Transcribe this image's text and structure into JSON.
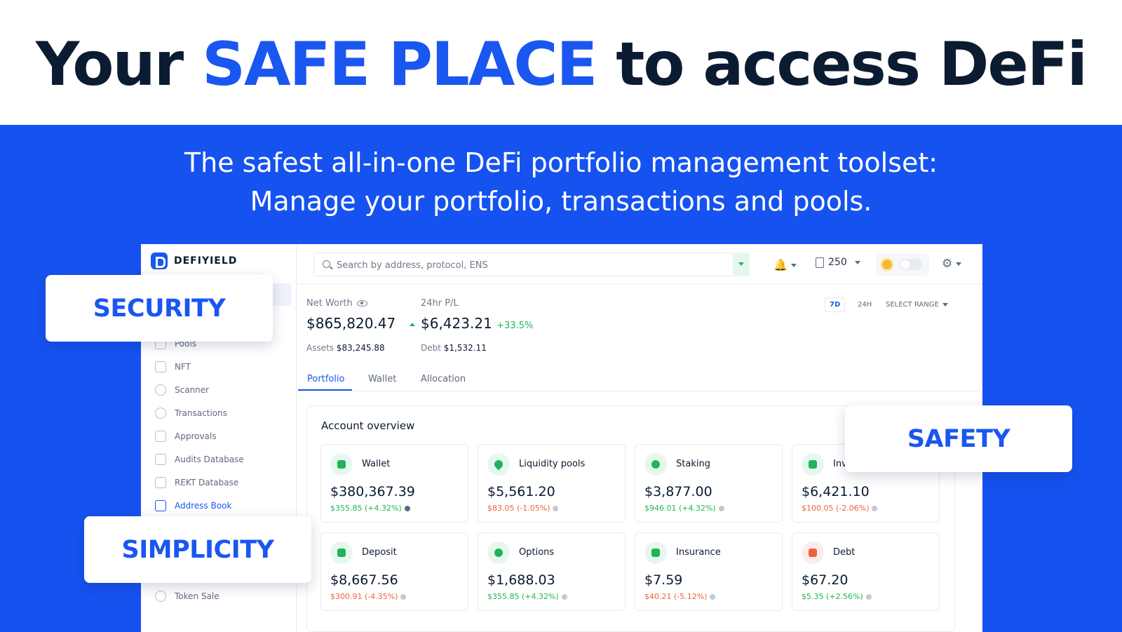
{
  "hero": {
    "title_pre": "Your ",
    "title_accent": "SAFE PLACE",
    "title_post": " to access DeFi",
    "tagline_1": "The safest all-in-one DeFi portfolio management toolset:",
    "tagline_2": "Manage your portfolio, transactions and pools."
  },
  "colors": {
    "brand_blue": "#1652f0",
    "accent": "#1a56f0",
    "positive": "#20b45a",
    "negative": "#f0623a",
    "ink": "#0b1b32"
  },
  "app": {
    "brand": "DEFIYIELD",
    "sidebar": {
      "items": [
        {
          "label": "Pools",
          "icon": "pools-icon"
        },
        {
          "label": "NFT",
          "icon": "nft-icon"
        },
        {
          "label": "Scanner",
          "icon": "scanner-icon"
        },
        {
          "label": "Transactions",
          "icon": "transactions-icon"
        },
        {
          "label": "Approvals",
          "icon": "approvals-icon"
        },
        {
          "label": "Audits Database",
          "icon": "audits-icon"
        },
        {
          "label": "REKT Database",
          "icon": "rekt-icon"
        },
        {
          "label": "Address Book",
          "icon": "address-book-icon",
          "active": true
        },
        {
          "label": "Token Sale",
          "icon": "token-sale-icon"
        }
      ]
    },
    "topbar": {
      "search_placeholder": "Search by address, protocol, ENS",
      "gas_value": "250"
    },
    "summary": {
      "net_worth_label": "Net Worth",
      "net_worth_value": "$865,820.47",
      "pl_label": "24hr P/L",
      "pl_value": "$6,423.21",
      "pl_pct": "+33.5%",
      "assets_label": "Assets",
      "assets_value": "$83,245.88",
      "debt_label": "Debt",
      "debt_value": "$1,532.11"
    },
    "range": {
      "opt_7d": "7D",
      "opt_24h": "24H",
      "select": "SELECT RANGE"
    },
    "tabs": [
      "Portfolio",
      "Wallet",
      "Allocation"
    ],
    "overview": {
      "title": "Account overview",
      "cards": [
        {
          "name": "Wallet",
          "value": "$380,367.39",
          "change": "$355.85 (+4.32%)",
          "trend": "up"
        },
        {
          "name": "Liquidity pools",
          "value": "$5,561.20",
          "change": "$83.05 (-1.05%)",
          "trend": "down"
        },
        {
          "name": "Staking",
          "value": "$3,877.00",
          "change": "$946.01 (+4.32%)",
          "trend": "up"
        },
        {
          "name": "Inv",
          "value": "$6,421.10",
          "change": "$100.05 (-2.06%)",
          "trend": "down"
        },
        {
          "name": "Deposit",
          "value": "$8,667.56",
          "change": "$300.91 (-4.35%)",
          "trend": "down"
        },
        {
          "name": "Options",
          "value": "$1,688.03",
          "change": "$355.85 (+4.32%)",
          "trend": "up"
        },
        {
          "name": "Insurance",
          "value": "$7.59",
          "change": "$40.21 (-5.12%)",
          "trend": "down"
        },
        {
          "name": "Debt",
          "value": "$67.20",
          "change": "$5.35 (+2.56%)",
          "trend": "up"
        }
      ]
    }
  },
  "badges": {
    "security": "SECURITY",
    "safety": "SAFETY",
    "simplicity": "SIMPLICITY"
  }
}
